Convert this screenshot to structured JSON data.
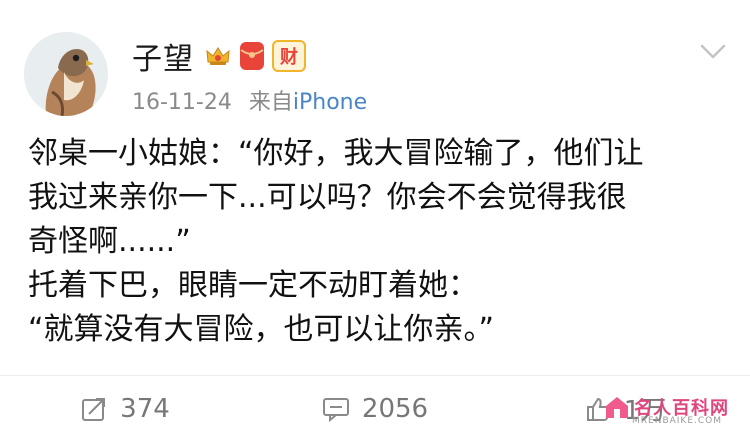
{
  "header": {
    "username": "子望",
    "badges": {
      "crown_icon": "crown-badge-icon",
      "red_icon": "red-envelope-icon",
      "cai_text": "财"
    },
    "timestamp": "16-11-24",
    "source_prefix": "来自",
    "source_name": "iPhone",
    "menu_icon": "chevron-down-icon"
  },
  "post": {
    "lines": [
      "邻桌一小姑娘：“你好，我大冒险输了，他们让",
      "我过来亲你一下...可以吗？你会不会觉得我很",
      "奇怪啊......”",
      "托着下巴，眼睛一定不动盯着她：",
      "“就算没有大冒险，也可以让你亲。”"
    ]
  },
  "actions": {
    "repost_count": "374",
    "comment_count": "2056",
    "like_count": "1万"
  },
  "watermark": {
    "text_cn": "名人百科网",
    "text_en": "MRENBAIKE.COM"
  },
  "colors": {
    "source": "#4a86c5",
    "meta": "#8a8a8a",
    "badge_gold": "#f1b52b",
    "badge_red": "#e8443a",
    "watermark": "#e0467e"
  }
}
